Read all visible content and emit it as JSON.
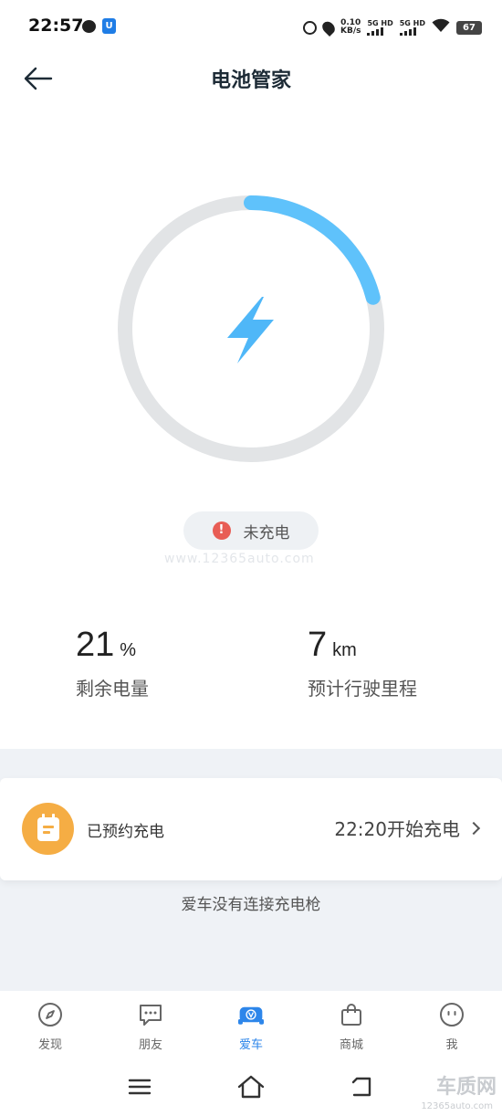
{
  "status_bar": {
    "time": "22:57",
    "net_speed_value": "0.10",
    "net_speed_unit": "KB/s",
    "sim1": "5G HD",
    "sim2": "5G HD",
    "battery": "67",
    "icons": [
      "chat-icon",
      "shield-app-icon",
      "alarm-icon",
      "location-icon",
      "wifi-icon",
      "battery-icon"
    ]
  },
  "header": {
    "title": "电池管家",
    "back_icon": "arrow-left-icon"
  },
  "battery_ring": {
    "charge_fraction": 0.21,
    "center_icon": "lightning-icon",
    "track_color": "#e2e4e6",
    "fill_color": "#5fc2fb"
  },
  "charging_status": {
    "label": "未充电",
    "icon": "warning-icon",
    "icon_color": "#e85d55"
  },
  "watermark": "www.12365auto.com",
  "stats": {
    "battery": {
      "value": "21",
      "unit": "%",
      "label": "剩余电量"
    },
    "range": {
      "value": "7",
      "unit": "km",
      "label": "预计行驶里程"
    }
  },
  "schedule_card": {
    "label": "已预约充电",
    "time_text": "22:20开始充电",
    "icon": "calendar-icon",
    "icon_bg": "#f5ad44"
  },
  "connection_message": "爱车没有连接充电枪",
  "bottom_nav": {
    "active_color": "#2d86ea",
    "items": [
      {
        "label": "发现",
        "icon": "compass-icon"
      },
      {
        "label": "朋友",
        "icon": "chat-dots-icon"
      },
      {
        "label": "爱车",
        "icon": "car-icon"
      },
      {
        "label": "商城",
        "icon": "shopping-bag-icon"
      },
      {
        "label": "我",
        "icon": "smiley-icon"
      }
    ]
  },
  "system_nav": {
    "icons": [
      "menu-icon",
      "home-icon",
      "back-icon"
    ]
  },
  "corner_logo": {
    "main": "车质网",
    "sub": "12365auto.com"
  }
}
